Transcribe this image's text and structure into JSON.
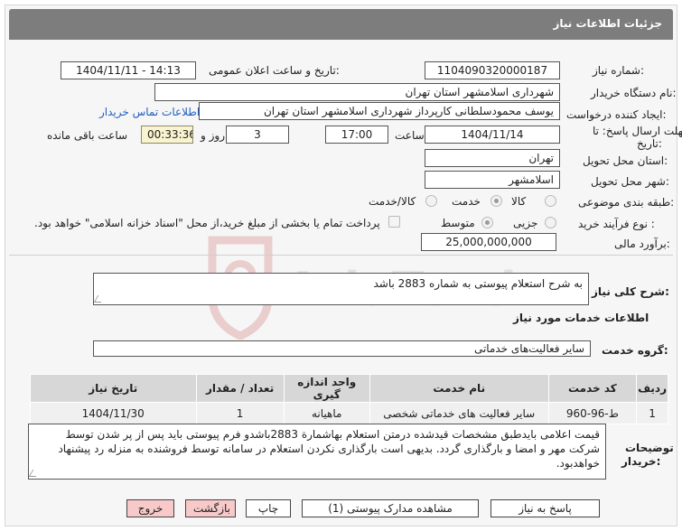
{
  "header": {
    "title": "جزئیات اطلاعات نیاز"
  },
  "fields": {
    "need_number_label": "شماره نیاز:",
    "need_number": "1104090320000187",
    "announce_label": "تاریخ و ساعت اعلان عمومی:",
    "announce_value": "1404/11/11 - 14:13",
    "buyer_org_label": "نام دستگاه خریدار:",
    "buyer_org": "شهرداری اسلامشهر استان تهران",
    "creator_label": "ایجاد کننده درخواست:",
    "creator": "یوسف محمودسلطانی کارپرداز شهرداری اسلامشهر استان تهران",
    "contact_link": "اطلاعات تماس خریدار",
    "deadline_label_1": "مهلت ارسال پاسخ: تا",
    "deadline_label_2": "تاریخ:",
    "deadline_date": "1404/11/14",
    "hour_label": "ساعت",
    "deadline_time": "17:00",
    "days_value": "3",
    "days_label": "روز و",
    "remaining_time": "00:33:36",
    "remaining_label": "ساعت باقی مانده",
    "province_label": "استان محل تحویل:",
    "province": "تهران",
    "city_label": "شهر محل تحویل:",
    "city": "اسلامشهر",
    "category_label": "طبقه بندی موضوعی:",
    "category_options": {
      "goods": "کالا",
      "service": "خدمت",
      "goods_service": "کالا/خدمت"
    },
    "process_label": "نوع فرآیند خرید :",
    "process_options": {
      "partial": "جزیی",
      "medium": "متوسط"
    },
    "payment_note": "پرداخت تمام یا بخشی از مبلغ خرید،از محل \"اسناد خزانه اسلامی\" خواهد بود.",
    "budget_label": "برآورد مالی:",
    "budget": "25,000,000,000"
  },
  "general_desc": {
    "label": "شرح کلی نیاز:",
    "text": "به شرح استعلام پیوستی به شماره 2883 باشد"
  },
  "services": {
    "section_title": "اطلاعات خدمات مورد نیاز",
    "group_label": "گروه خدمت:",
    "group_value": "سایر فعالیت‌های خدماتی",
    "table": {
      "headers": [
        "ردیف",
        "کد خدمت",
        "نام خدمت",
        "واحد اندازه گیری",
        "تعداد / مقدار",
        "تاریخ نیاز"
      ],
      "rows": [
        [
          "1",
          "ط-96-960",
          "سایر فعالیت های خدماتی شخصی",
          "ماهیانه",
          "1",
          "1404/11/30"
        ]
      ]
    }
  },
  "buyer_notes": {
    "label_1": "توضیحات",
    "label_2": "خریدار:",
    "text": "قیمت اعلامی بایدطبق مشخصات قیدشده درمتن استعلام بهاشمارة  2883باشدو فرم پیوستی باید پس از پر شدن توسط شرکت مهر و امضا و بارگذاری گردد. بدیهی است بارگذاری نکردن استعلام در سامانه توسط فروشنده به منزله رد پیشنهاد خواهدبود."
  },
  "buttons": {
    "reply": "پاسخ به نیاز",
    "view_docs": "مشاهده مدارک پیوستی (1)",
    "print": "چاپ",
    "back": "بازگشت",
    "exit": "خروج"
  },
  "watermark": {
    "text": "AriaTender.net"
  }
}
